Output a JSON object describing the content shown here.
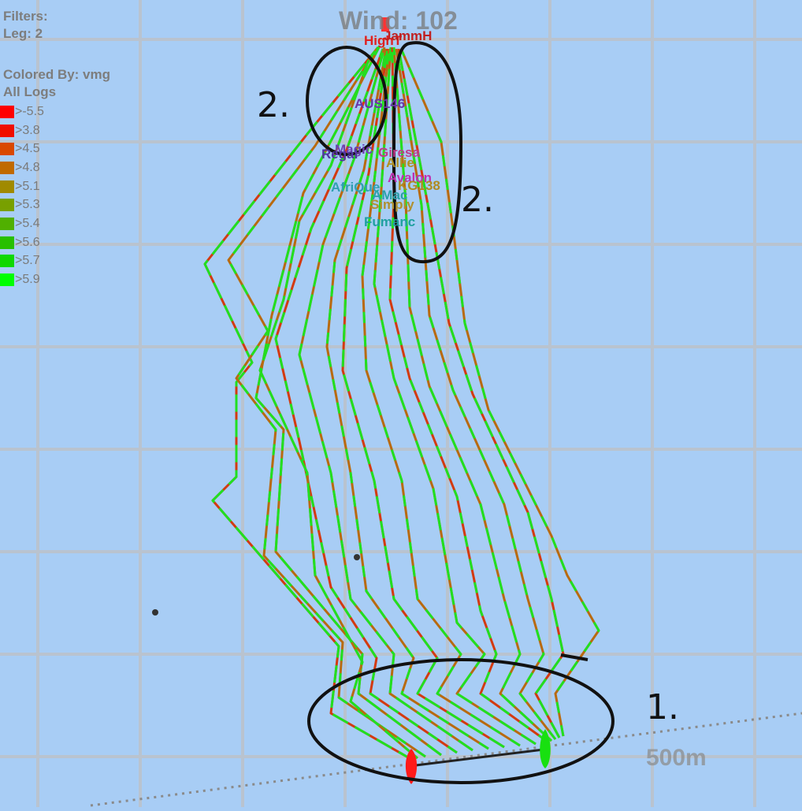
{
  "filters": {
    "title": "Filters:",
    "leg": "Leg: 2"
  },
  "colored_by": {
    "title": "Colored By: vmg",
    "subtitle": "All Logs"
  },
  "legend": [
    {
      "label": ">-5.5",
      "color": "#ff0000"
    },
    {
      "label": ">3.8",
      "color": "#f00d00"
    },
    {
      "label": ">4.5",
      "color": "#d94800"
    },
    {
      "label": ">4.8",
      "color": "#c06a00"
    },
    {
      "label": ">5.1",
      "color": "#a08a00"
    },
    {
      "label": ">5.3",
      "color": "#78a000"
    },
    {
      "label": ">5.4",
      "color": "#50b000"
    },
    {
      "label": ">5.6",
      "color": "#28c000"
    },
    {
      "label": ">5.7",
      "color": "#10d800"
    },
    {
      "label": ">5.9",
      "color": "#00ff00"
    }
  ],
  "wind_label": "Wind: 102",
  "scale_label": "500m",
  "boats": [
    {
      "name": "HighT",
      "color": "#e02020"
    },
    {
      "name": "JammH",
      "color": "#c02020"
    },
    {
      "name": "AUS146",
      "color": "#6a35a8"
    },
    {
      "name": "Magic",
      "color": "#7040b0"
    },
    {
      "name": "Regal",
      "color": "#5035a0"
    },
    {
      "name": "Giresa",
      "color": "#c03a8a"
    },
    {
      "name": "Allie",
      "color": "#b09020"
    },
    {
      "name": "Avalon",
      "color": "#c030b0"
    },
    {
      "name": "AfriQue",
      "color": "#30a0b0"
    },
    {
      "name": "KG138",
      "color": "#b08a20"
    },
    {
      "name": "AMac",
      "color": "#2aa0a8"
    },
    {
      "name": "Simply",
      "color": "#b09030"
    },
    {
      "name": "Fumanc",
      "color": "#20a0a0"
    }
  ],
  "annotations": {
    "start_label": "1.",
    "top_label_left": "2.",
    "top_label_right": "2."
  },
  "colors": {
    "water": "#a8cdf5",
    "grid": "#b9c3cf",
    "ink": "#111111"
  }
}
